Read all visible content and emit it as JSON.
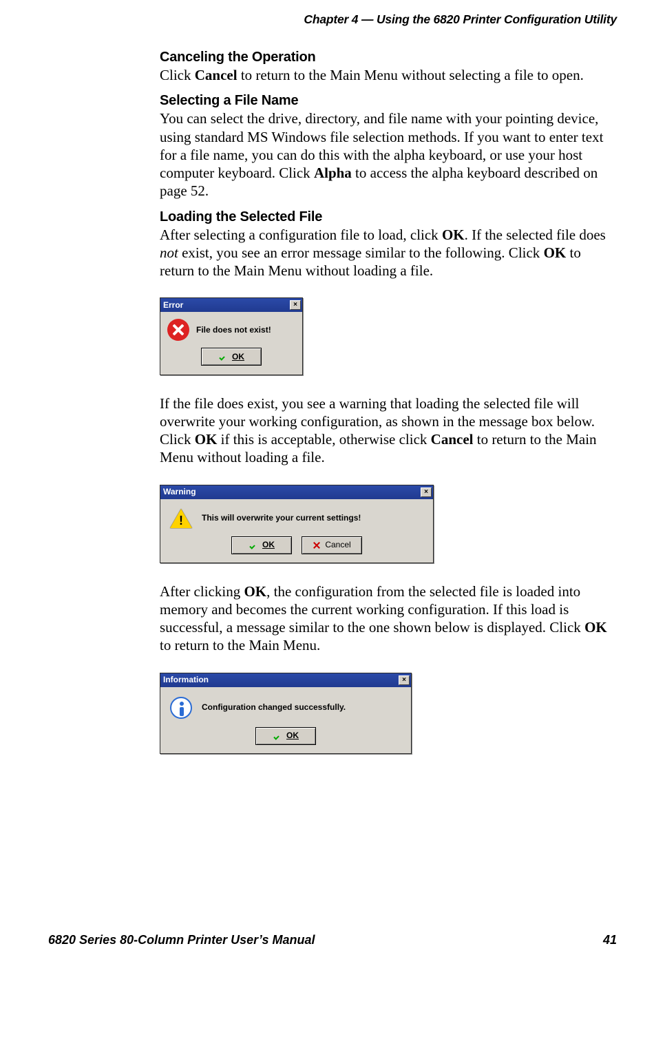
{
  "header": {
    "chapter_prefix": "Chapter  4  —  ",
    "chapter_title": "Using the 6820 Printer Configuration Utility"
  },
  "sections": {
    "s1_head": "Canceling the  Operation",
    "s1_para_pre": "Click ",
    "s1_para_b1": "Cancel",
    "s1_para_post": " to return to the Main Menu without selecting a file to open.",
    "s2_head": "Selecting a File Name",
    "s2_para_pre": "You can select the drive, directory, and file name with your pointing device, using standard MS Windows file selection methods. If you want to enter text for a file name, you can do this with the alpha keyboard, or use your host computer keyboard. Click ",
    "s2_para_b1": "Alpha",
    "s2_para_post": " to access the alpha keyboard described on page 52.",
    "s3_head": "Loading the Selected File",
    "s3_p1_pre": "After selecting a configuration file to load, click ",
    "s3_p1_b1": "OK",
    "s3_p1_mid1": ". If the selected file does ",
    "s3_p1_i1": "not",
    "s3_p1_mid2": " exist, you see an error message similar to the following. Click ",
    "s3_p1_b2": "OK",
    "s3_p1_post": " to return to the Main Menu without loading a file.",
    "s3_p2_pre": "If the file does exist, you see a warning that loading the selected file will overwrite your working configuration, as shown in the message box below. Click ",
    "s3_p2_b1": "OK",
    "s3_p2_mid": " if this is acceptable, otherwise click ",
    "s3_p2_b2": "Cancel",
    "s3_p2_post": " to return to the Main Menu without loading a file.",
    "s3_p3_pre": "After clicking ",
    "s3_p3_b1": "OK",
    "s3_p3_mid": ", the configuration from the selected file is loaded into memory and becomes the current working configuration. If this load is successful, a message similar to the one shown below is displayed. Click ",
    "s3_p3_b2": "OK",
    "s3_p3_post": " to return to the Main Menu."
  },
  "dialogs": {
    "error": {
      "title": "Error",
      "message": "File does not exist!",
      "ok_label": "OK"
    },
    "warning": {
      "title": "Warning",
      "message": "This will overwrite your current settings!",
      "ok_label": "OK",
      "cancel_label": "Cancel"
    },
    "info": {
      "title": "Information",
      "message": "Configuration changed successfully.",
      "ok_label": "OK"
    }
  },
  "footer": {
    "left": "6820 Series 80-Column Printer User’s Manual",
    "right": "41"
  }
}
